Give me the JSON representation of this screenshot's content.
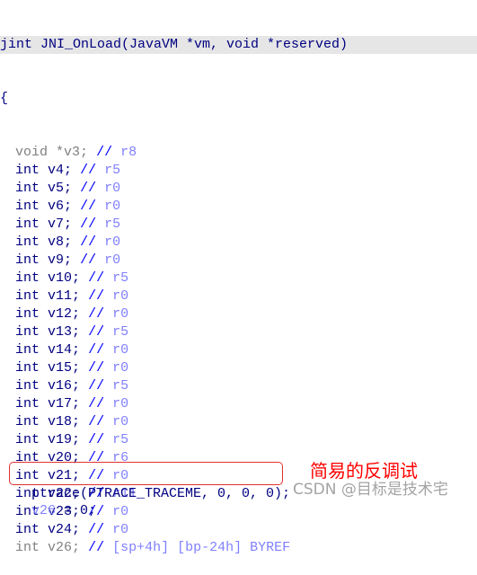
{
  "header": {
    "signature": "jint JNI_OnLoad(JavaVM *vm, void *reserved)"
  },
  "open_brace": "{",
  "comment_marker": "//",
  "declarations": [
    {
      "type": "void",
      "name": "*v3;",
      "location": "r8",
      "dim": true
    },
    {
      "type": "int",
      "name": "v4;",
      "location": "r5",
      "dim": false
    },
    {
      "type": "int",
      "name": "v5;",
      "location": "r0",
      "dim": false
    },
    {
      "type": "int",
      "name": "v6;",
      "location": "r0",
      "dim": false
    },
    {
      "type": "int",
      "name": "v7;",
      "location": "r5",
      "dim": false
    },
    {
      "type": "int",
      "name": "v8;",
      "location": "r0",
      "dim": false
    },
    {
      "type": "int",
      "name": "v9;",
      "location": "r0",
      "dim": false
    },
    {
      "type": "int",
      "name": "v10;",
      "location": "r5",
      "dim": false
    },
    {
      "type": "int",
      "name": "v11;",
      "location": "r0",
      "dim": false
    },
    {
      "type": "int",
      "name": "v12;",
      "location": "r0",
      "dim": false
    },
    {
      "type": "int",
      "name": "v13;",
      "location": "r5",
      "dim": false
    },
    {
      "type": "int",
      "name": "v14;",
      "location": "r0",
      "dim": false
    },
    {
      "type": "int",
      "name": "v15;",
      "location": "r0",
      "dim": false
    },
    {
      "type": "int",
      "name": "v16;",
      "location": "r5",
      "dim": false
    },
    {
      "type": "int",
      "name": "v17;",
      "location": "r0",
      "dim": false
    },
    {
      "type": "int",
      "name": "v18;",
      "location": "r0",
      "dim": false
    },
    {
      "type": "int",
      "name": "v19;",
      "location": "r5",
      "dim": false
    },
    {
      "type": "int",
      "name": "v20;",
      "location": "r6",
      "dim": false
    },
    {
      "type": "int",
      "name": "v21;",
      "location": "r0",
      "dim": false
    },
    {
      "type": "int",
      "name": "v22;",
      "location": "r11",
      "dim": false
    },
    {
      "type": "int",
      "name": "v23;",
      "location": "r0",
      "dim": false
    },
    {
      "type": "int",
      "name": "v24;",
      "location": "r0",
      "dim": false
    },
    {
      "type": "int",
      "name": "v26;",
      "location": "[sp+4h] [bp-24h] BYREF",
      "dim": true
    }
  ],
  "statements": {
    "ptrace": "ptrace(PTRACE_TRACEME, 0, 0, 0);",
    "assign_var": "v26",
    "assign_rest": " = 0;"
  },
  "annotation": {
    "text": "简易的反调试",
    "color": "#ff0000"
  },
  "watermark": "CSDN @目标是技术宅",
  "colors": {
    "keyword": "#000080",
    "dimmed": "#808080",
    "comment": "#0000ff",
    "register": "#8080ff",
    "highlight_box": "#e03030"
  }
}
